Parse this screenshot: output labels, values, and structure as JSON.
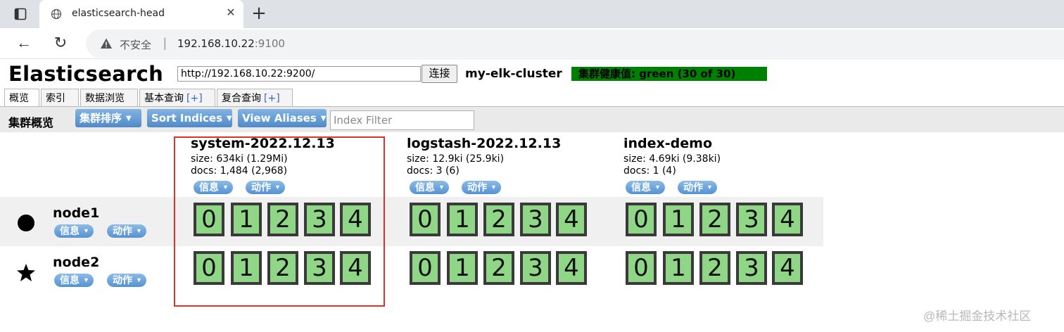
{
  "browser": {
    "tab_title": "elasticsearch-head",
    "close_glyph": "✕",
    "new_tab_glyph": "+",
    "back_glyph": "←",
    "reload_glyph": "↻",
    "security_label": "不安全",
    "separator": "|",
    "url_host": "192.168.10.22",
    "url_port": ":9100"
  },
  "header": {
    "brand": "Elasticsearch",
    "connect_url": "http://192.168.10.22:9200/",
    "connect_label": "连接",
    "cluster_name": "my-elk-cluster",
    "health_text": "集群健康值: green (30 of 30)",
    "health_color": "#008000"
  },
  "tabs": [
    {
      "label": "概览",
      "active": true
    },
    {
      "label": "索引"
    },
    {
      "label": "数据浏览"
    },
    {
      "label": "基本查询",
      "plus": "[+]"
    },
    {
      "label": "复合查询",
      "plus": "[+]"
    }
  ],
  "overview": {
    "title": "集群概览",
    "sort_cluster": "集群排序",
    "sort_indices": "Sort Indices",
    "view_aliases": "View Aliases",
    "filter_placeholder": "Index Filter"
  },
  "indices": [
    {
      "name": "system-2022.12.13",
      "size": "size: 634ki (1.29Mi)",
      "docs": "docs: 1,484 (2,968)",
      "info_label": "信息",
      "action_label": "动作"
    },
    {
      "name": "logstash-2022.12.13",
      "size": "size: 12.9ki (25.9ki)",
      "docs": "docs: 3 (6)",
      "info_label": "信息",
      "action_label": "动作"
    },
    {
      "name": "index-demo",
      "size": "size: 4.69ki (9.38ki)",
      "docs": "docs: 1 (4)",
      "info_label": "信息",
      "action_label": "动作"
    }
  ],
  "nodes": [
    {
      "name": "node1",
      "icon": "circle-icon",
      "info_label": "信息",
      "action_label": "动作"
    },
    {
      "name": "node2",
      "icon": "star-icon",
      "info_label": "信息",
      "action_label": "动作"
    }
  ],
  "shards": [
    "0",
    "1",
    "2",
    "3",
    "4"
  ],
  "shard_color": "#8fd787",
  "watermark": "@稀土掘金技术社区"
}
